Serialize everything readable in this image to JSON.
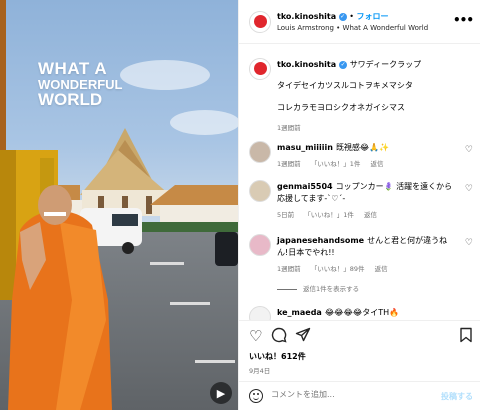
{
  "video": {
    "title_line1": "WHAT A",
    "title_line2": "WONDERFUL",
    "title_line3": "WORLD",
    "reel_icon": "reel-icon"
  },
  "header": {
    "username": "tko.kinoshita",
    "separator": "•",
    "follow_label": "フォロー",
    "audio": "Louis Armstrong • What A Wonderful World",
    "more_icon": "more-horizontal-icon"
  },
  "caption": {
    "username": "tko.kinoshita",
    "text_line1": "サワディークラップ",
    "text_line2": "タイデセイカツスルコトヲキメマシタ",
    "text_line3": "コレカラモヨロシクオネガイシマス",
    "time": "1週間前"
  },
  "comments": [
    {
      "username": "masu_miiiiin",
      "text": "既視感😂🙏✨",
      "time": "1週間前",
      "likes": "「いいね！」1件",
      "reply": "返信"
    },
    {
      "username": "genmai5504",
      "text": "コップンカー🪻 活躍を遠くから応援してます-`♡´-",
      "time": "5日前",
      "likes": "「いいね！」1件",
      "reply": "返信"
    },
    {
      "username": "japanesehandsome",
      "text": "せんと君と何が違うねん!日本でやれ!!",
      "time": "1週間前",
      "likes": "「いいね！」89件",
      "reply": "返信",
      "view_replies": "返信1件を表示する"
    },
    {
      "username": "ke_maeda",
      "text": "😂😂😂😂タイTH🔥"
    }
  ],
  "actions": {
    "like_icon": "heart-icon",
    "comment_icon": "comment-icon",
    "share_icon": "send-icon",
    "save_icon": "bookmark-icon",
    "likes_text": "いいね！612件",
    "date": "9月4日"
  },
  "comment_bar": {
    "emoji_icon": "emoji-icon",
    "placeholder": "コメントを追加...",
    "post_label": "投稿する"
  }
}
